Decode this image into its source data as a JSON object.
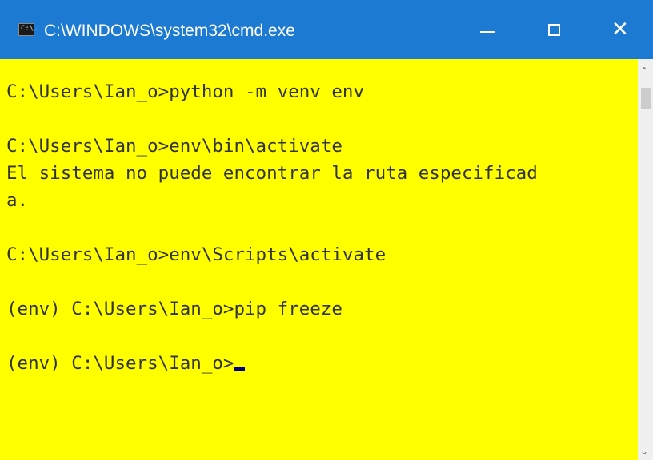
{
  "window": {
    "title": "C:\\WINDOWS\\system32\\cmd.exe",
    "icon": "cmd-icon",
    "icon_text": "C:\\.",
    "buttons": {
      "minimize": "minimize-icon",
      "maximize": "maximize-icon",
      "close": "close-icon",
      "close_glyph": "✕"
    }
  },
  "colors": {
    "titlebar": "#1c7ad2",
    "console_background": "#ffff00",
    "console_text": "#333333",
    "cursor": "#000080"
  },
  "console": {
    "lines": [
      "C:\\Users\\Ian_o>python -m venv env",
      "",
      "C:\\Users\\Ian_o>env\\bin\\activate",
      "El sistema no puede encontrar la ruta especificad",
      "a.",
      "",
      "C:\\Users\\Ian_o>env\\Scripts\\activate",
      "",
      "(env) C:\\Users\\Ian_o>pip freeze",
      "",
      "(env) C:\\Users\\Ian_o>"
    ]
  },
  "scrollbar": {
    "up": "⌃",
    "down": "⌄"
  }
}
